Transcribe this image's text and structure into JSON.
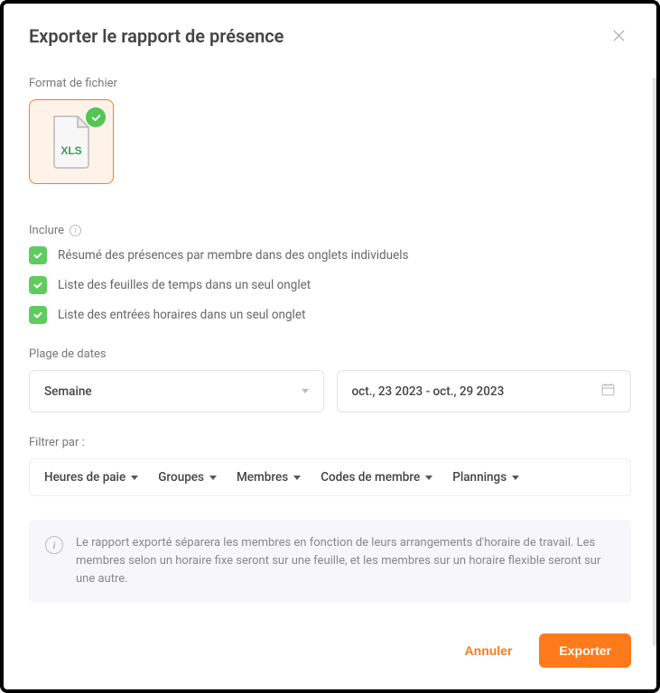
{
  "modal": {
    "title": "Exporter le rapport de présence"
  },
  "fileFormat": {
    "label": "Format de fichier",
    "selected": "XLS"
  },
  "include": {
    "label": "Inclure",
    "options": [
      {
        "label": "Résumé des présences par membre dans des onglets individuels",
        "checked": true
      },
      {
        "label": "Liste des feuilles de temps dans un seul onglet",
        "checked": true
      },
      {
        "label": "Liste des entrées horaires dans un seul onglet",
        "checked": true
      }
    ]
  },
  "dateRange": {
    "label": "Plage de dates",
    "periodSelected": "Semaine",
    "rangeText": "oct., 23 2023 - oct., 29 2023"
  },
  "filters": {
    "label": "Filtrer par :",
    "items": [
      "Heures de paie",
      "Groupes",
      "Membres",
      "Codes de membre",
      "Plannings"
    ]
  },
  "infoBox": {
    "text": "Le rapport exporté séparera les membres en fonction de leurs arrangements d'horaire de travail. Les membres selon un horaire fixe seront sur une feuille, et les membres sur un horaire flexible seront sur une autre."
  },
  "actions": {
    "cancel": "Annuler",
    "export": "Exporter"
  }
}
